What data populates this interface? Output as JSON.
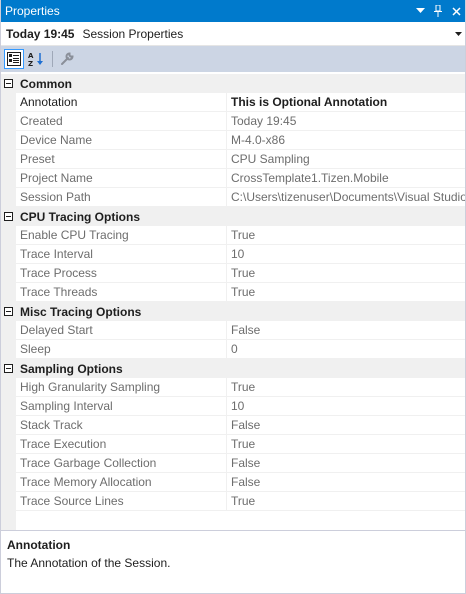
{
  "window": {
    "title": "Properties",
    "buttons": [
      "dropdown",
      "pin",
      "close"
    ]
  },
  "selector": {
    "object_name": "Today 19:45",
    "object_type": "Session Properties"
  },
  "toolbar": {
    "tools": [
      {
        "name": "categorized-icon",
        "active": true
      },
      {
        "name": "alphabetical-icon",
        "active": false
      },
      {
        "name": "property-pages-icon",
        "active": false
      }
    ]
  },
  "categories": [
    {
      "label": "Common",
      "properties": [
        {
          "name": "Annotation",
          "value": "This is Optional Annotation",
          "editable": true
        },
        {
          "name": "Created",
          "value": "Today 19:45"
        },
        {
          "name": "Device Name",
          "value": "M-4.0-x86"
        },
        {
          "name": "Preset",
          "value": "CPU Sampling"
        },
        {
          "name": "Project Name",
          "value": "CrossTemplate1.Tizen.Mobile"
        },
        {
          "name": "Session Path",
          "value": "C:\\Users\\tizenuser\\Documents\\Visual Studio"
        }
      ]
    },
    {
      "label": "CPU Tracing Options",
      "properties": [
        {
          "name": "Enable CPU Tracing",
          "value": "True"
        },
        {
          "name": "Trace Interval",
          "value": "10"
        },
        {
          "name": "Trace Process",
          "value": "True"
        },
        {
          "name": "Trace Threads",
          "value": "True"
        }
      ]
    },
    {
      "label": "Misc Tracing Options",
      "properties": [
        {
          "name": "Delayed Start",
          "value": "False"
        },
        {
          "name": "Sleep",
          "value": "0"
        }
      ]
    },
    {
      "label": "Sampling Options",
      "properties": [
        {
          "name": "High Granularity Sampling",
          "value": "True"
        },
        {
          "name": "Sampling Interval",
          "value": "10"
        },
        {
          "name": "Stack Track",
          "value": "False"
        },
        {
          "name": "Trace Execution",
          "value": "True"
        },
        {
          "name": "Trace Garbage Collection",
          "value": "False"
        },
        {
          "name": "Trace Memory Allocation",
          "value": "False"
        },
        {
          "name": "Trace Source Lines",
          "value": "True"
        }
      ]
    }
  ],
  "description": {
    "title": "Annotation",
    "text": "The Annotation of the Session."
  },
  "colors": {
    "titlebar": "#007acc",
    "toolbar": "#ccd5e4",
    "category_bg": "#f0f0f0",
    "readonly_text": "#6d6d6d"
  }
}
